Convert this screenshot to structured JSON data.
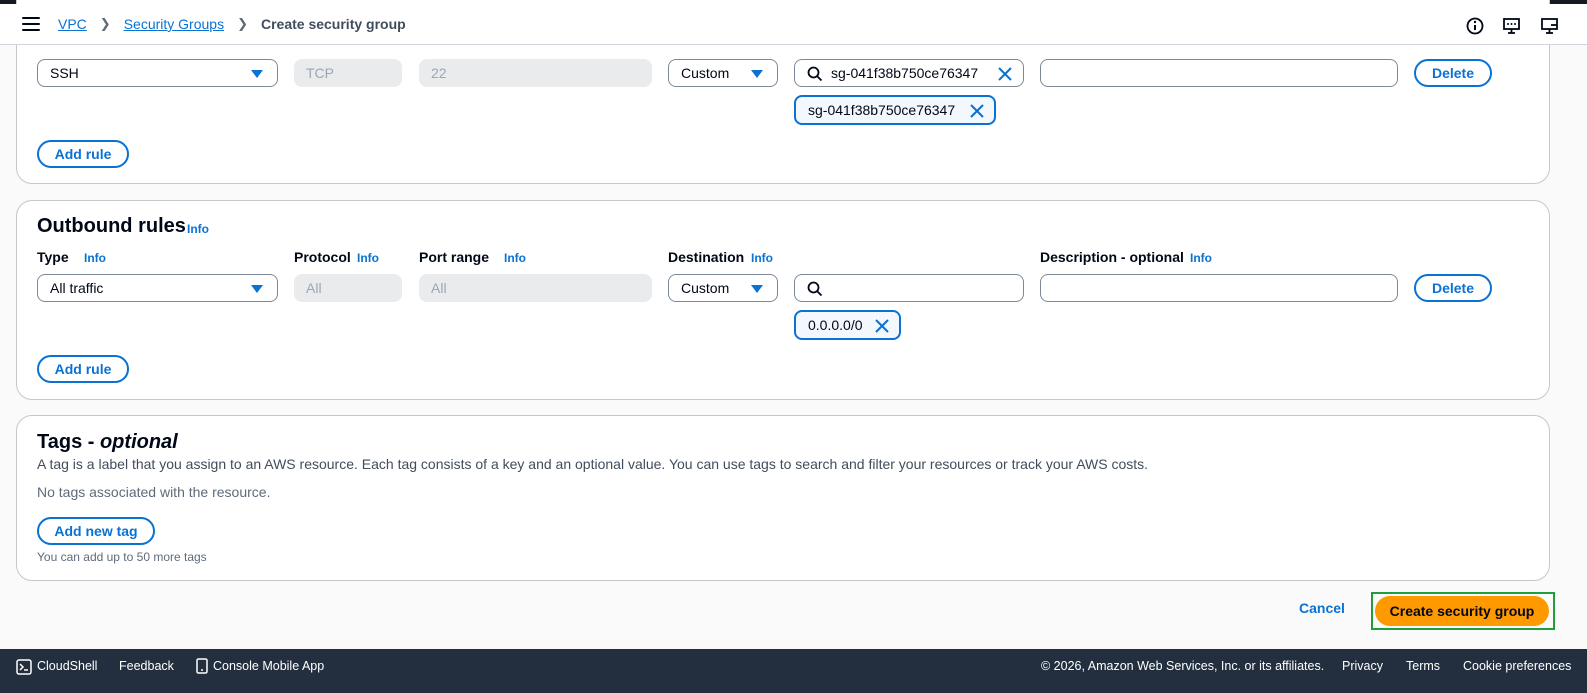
{
  "header": {
    "breadcrumbs": [
      {
        "label": "VPC"
      },
      {
        "label": "Security Groups"
      },
      {
        "label": "Create security group"
      }
    ]
  },
  "inbound": {
    "rule": {
      "type": "SSH",
      "protocol": "TCP",
      "port_range": "22",
      "source_mode": "Custom",
      "search_value": "sg-041f38b750ce76347",
      "token": "sg-041f38b750ce76347",
      "description": "",
      "delete_label": "Delete"
    },
    "add_rule_label": "Add rule"
  },
  "outbound": {
    "title": "Outbound rules",
    "info": "Info",
    "columns": {
      "type": "Type",
      "protocol": "Protocol",
      "port_range": "Port range",
      "destination": "Destination",
      "description": "Description - optional"
    },
    "rule": {
      "type": "All traffic",
      "protocol": "All",
      "port_range": "All",
      "destination_mode": "Custom",
      "search_value": "",
      "token": "0.0.0.0/0",
      "description": "",
      "delete_label": "Delete"
    },
    "add_rule_label": "Add rule"
  },
  "tags": {
    "title_main": "Tags - ",
    "title_optional": "optional",
    "description": "A tag is a label that you assign to an AWS resource. Each tag consists of a key and an optional value. You can use tags to search and filter your resources or track your AWS costs.",
    "empty_text": "No tags associated with the resource.",
    "add_tag_label": "Add new tag",
    "limit_text": "You can add up to 50 more tags"
  },
  "actions": {
    "cancel_label": "Cancel",
    "create_label": "Create security group"
  },
  "footer": {
    "cloudshell": "CloudShell",
    "feedback": "Feedback",
    "mobile_app": "Console Mobile App",
    "copyright": "© 2026, Amazon Web Services, Inc. or its affiliates.",
    "privacy": "Privacy",
    "terms": "Terms",
    "cookies": "Cookie preferences"
  },
  "colors": {
    "link": "#0972d3",
    "primary_button": "#ff9900",
    "footer_bg": "#232f3e",
    "highlight": "#1e9e3d"
  }
}
